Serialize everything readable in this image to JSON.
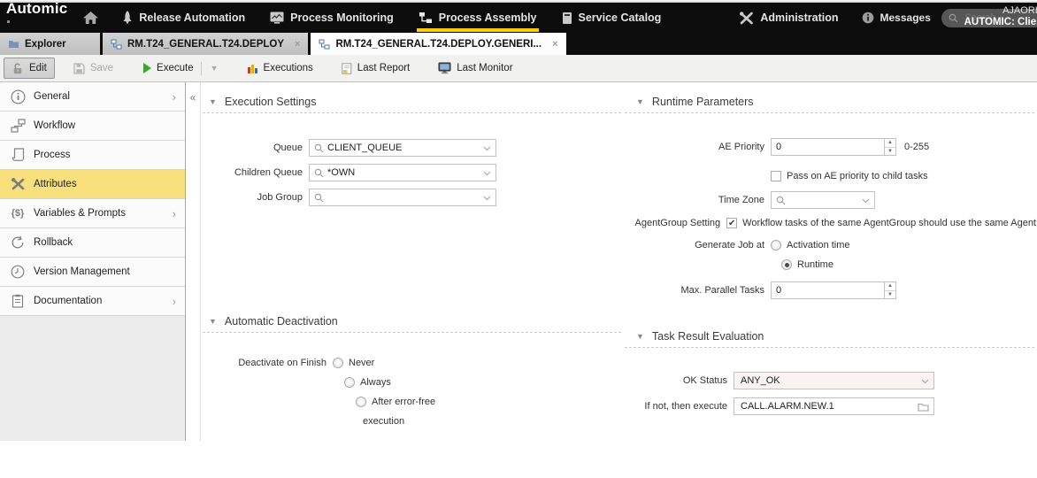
{
  "topnav": {
    "logo": "Automic",
    "items": [
      {
        "label": "Release Automation"
      },
      {
        "label": "Process Monitoring"
      },
      {
        "label": "Process Assembly"
      },
      {
        "label": "Service Catalog"
      },
      {
        "label": "Administration"
      }
    ],
    "messages_label": "Messages",
    "search": {
      "placeholder": "Search"
    },
    "user": {
      "name": "AJAORIM",
      "client": "AUTOMIC: Client"
    }
  },
  "tabbar": {
    "tabs": [
      {
        "label": "Explorer"
      },
      {
        "label": "RM.T24_GENERAL.T24.DEPLOY"
      },
      {
        "label": "RM.T24_GENERAL.T24.DEPLOY.GENERI..."
      }
    ]
  },
  "toolbar": {
    "edit_label": "Edit",
    "save_label": "Save",
    "execute_label": "Execute",
    "executions_label": "Executions",
    "last_report_label": "Last Report",
    "last_monitor_label": "Last Monitor"
  },
  "sidebar": {
    "items": [
      {
        "label": "General"
      },
      {
        "label": "Workflow"
      },
      {
        "label": "Process"
      },
      {
        "label": "Attributes"
      },
      {
        "label": "Variables & Prompts"
      },
      {
        "label": "Rollback"
      },
      {
        "label": "Version Management"
      },
      {
        "label": "Documentation"
      }
    ],
    "active_item": "Attributes"
  },
  "sections": {
    "execution_settings": {
      "title": "Execution Settings",
      "fields": {
        "queue": {
          "label": "Queue",
          "value": "CLIENT_QUEUE"
        },
        "children_queue": {
          "label": "Children Queue",
          "value": "*OWN"
        },
        "job_group": {
          "label": "Job Group",
          "value": ""
        }
      }
    },
    "runtime_parameters": {
      "title": "Runtime Parameters",
      "fields": {
        "ae_priority": {
          "label": "AE Priority",
          "value": "0",
          "hint": "0-255"
        },
        "pass_on": {
          "label": "Pass on AE priority to child tasks",
          "checked": false
        },
        "time_zone": {
          "label": "Time Zone",
          "value": ""
        },
        "agentgroup": {
          "label": "AgentGroup Setting",
          "checkbox_label": "Workflow tasks of the same AgentGroup should use the same Agent",
          "checked": true
        },
        "generate_job": {
          "label": "Generate Job at",
          "options": [
            "Activation time",
            "Runtime"
          ],
          "selected": "Runtime"
        },
        "max_parallel": {
          "label": "Max. Parallel Tasks",
          "value": "0"
        }
      }
    },
    "automatic_deactivation": {
      "title": "Automatic Deactivation",
      "fields": {
        "deactivate": {
          "label": "Deactivate on Finish",
          "options": [
            "Never",
            "Always",
            "After error-free"
          ],
          "wrap": "execution",
          "selected": ""
        }
      }
    },
    "task_result": {
      "title": "Task Result Evaluation",
      "fields": {
        "ok_status": {
          "label": "OK Status",
          "value": "ANY_OK"
        },
        "if_not": {
          "label": "If not, then execute",
          "value": "CALL.ALARM.NEW.1"
        }
      }
    }
  },
  "colors": {
    "accent_yellow": "#ffcc00",
    "active_sidebar_yellow": "#f8e17c",
    "execute_green": "#3ea52f",
    "ok_status_bg": "#fbf2f4",
    "navbar_bg": "#0c0c0c"
  }
}
